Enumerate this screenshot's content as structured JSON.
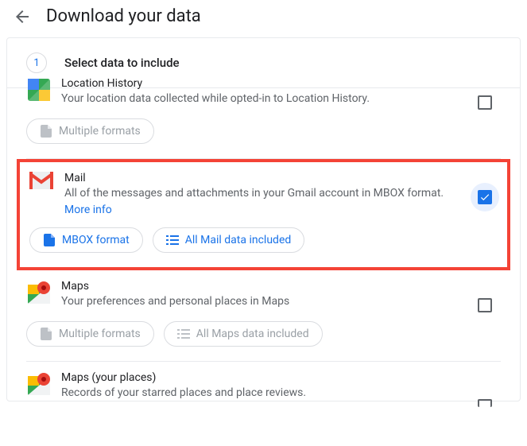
{
  "header": {
    "page_title": "Download your data"
  },
  "step": {
    "number": "1",
    "title": "Select data to include"
  },
  "services": {
    "location_history": {
      "name": "Location History",
      "desc": "Your location data collected while opted-in to Location History.",
      "format_chip": "Multiple formats"
    },
    "mail": {
      "name": "Mail",
      "desc": "All of the messages and attachments in your Gmail account in MBOX format.",
      "more_info": "More info",
      "format_chip": "MBOX format",
      "data_chip": "All Mail data included"
    },
    "maps": {
      "name": "Maps",
      "desc": "Your preferences and personal places in Maps",
      "format_chip": "Multiple formats",
      "data_chip": "All Maps data included"
    },
    "maps_places": {
      "name": "Maps (your places)",
      "desc": "Records of your starred places and place reviews."
    }
  }
}
